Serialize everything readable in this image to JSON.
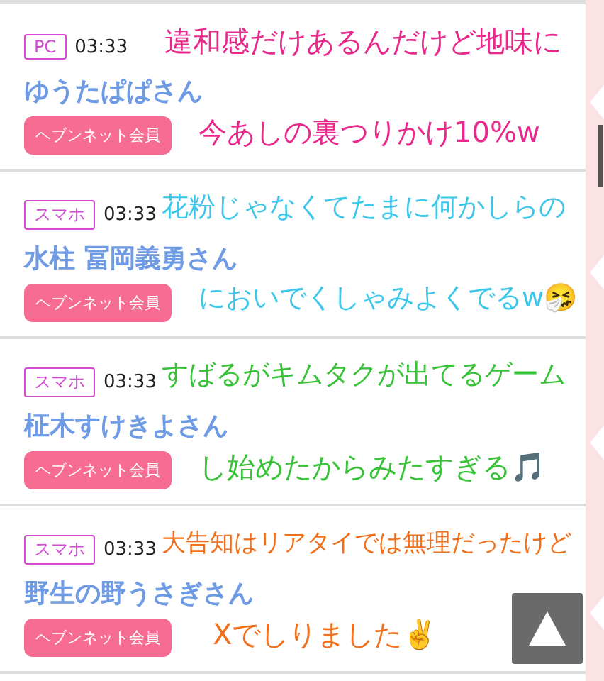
{
  "posts": [
    {
      "device": "PC",
      "time": "03:33",
      "name": "ゆうたぱぱさん",
      "member_button": "ヘブンネット会員",
      "caption": {
        "color": "#e8288a",
        "lines": [
          "違和感だけあるんだけど地味に",
          "今あしの裏つりかけ10%w"
        ]
      }
    },
    {
      "device": "スマホ",
      "time": "03:33",
      "name": "水柱 冨岡義勇さん",
      "member_button": "ヘブンネット会員",
      "caption": {
        "color": "#3cc6ea",
        "lines": [
          "花粉じゃなくてたまに何かしらの",
          "においでくしゃみよくでるw🤧"
        ]
      }
    },
    {
      "device": "スマホ",
      "time": "03:33",
      "name": "柾木すけきよさん",
      "member_button": "ヘブンネット会員",
      "caption": {
        "color": "#38c238",
        "lines": [
          "すばるがキムタクが出てるゲーム",
          "し始めたからみたすぎる🎵"
        ]
      }
    },
    {
      "device": "スマホ",
      "time": "03:33",
      "name": "野生の野うさぎさん",
      "member_button": "ヘブンネット会員",
      "caption": {
        "color": "#f0701e",
        "lines": [
          "大告知はリアタイでは無理だったけど",
          "Xでしりました✌️"
        ]
      }
    }
  ]
}
